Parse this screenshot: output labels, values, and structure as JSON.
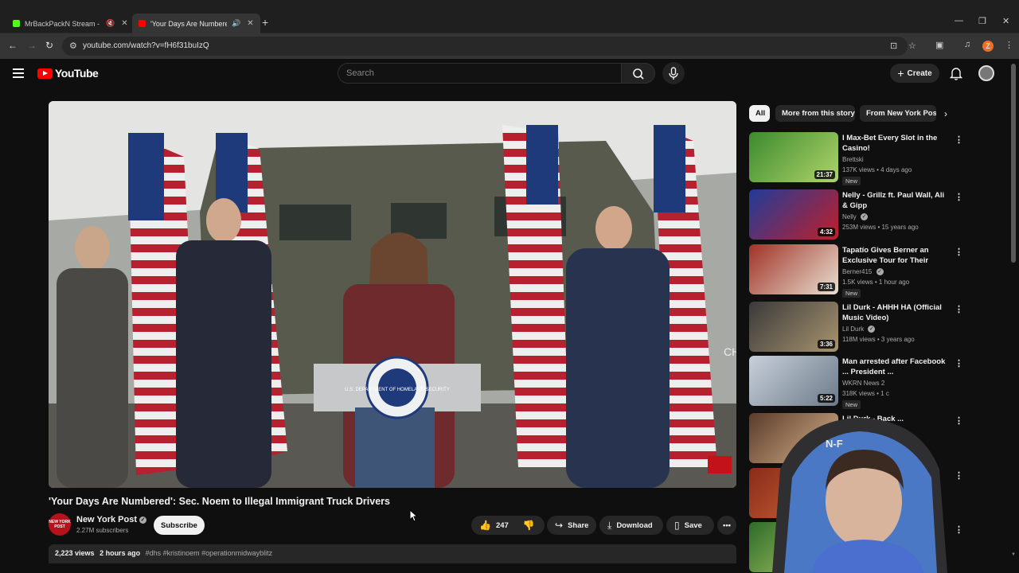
{
  "browser": {
    "tabs": [
      {
        "title": "MrBackPackN Stream - Wa",
        "favicon_color": "#53fc18",
        "active": false
      },
      {
        "title": "'Your Days Are Numbered':",
        "favicon_color": "#ff0000",
        "active": true
      }
    ],
    "url": "youtube.com/watch?v=fH6f31buIzQ",
    "profile_initial": "Z"
  },
  "header": {
    "logo_text": "YouTube",
    "search_placeholder": "Search",
    "create_label": "Create"
  },
  "video": {
    "title": "'Your Days Are Numbered': Sec. Noem to Illegal Immigrant Truck Drivers",
    "channel": "New York Post",
    "channel_avatar_text": "NEW YORK POST",
    "subscribers": "2.27M subscribers",
    "subscribe_label": "Subscribe",
    "likes": "247",
    "share_label": "Share",
    "download_label": "Download",
    "save_label": "Save",
    "views": "2,223 views",
    "age": "2 hours ago",
    "tags": "#dhs #kristinoem #operationmidwayblitz",
    "podium_text": "U.S. DEPARTMENT OF HOMELAND SECURITY",
    "overlay_text": "CH"
  },
  "chips": [
    "All",
    "More from this story",
    "From New York Post"
  ],
  "recommendations": [
    {
      "title": "I Max-Bet Every Slot in the Casino!",
      "channel": "Brettski",
      "verified": false,
      "meta": "137K views • 4 days ago",
      "new_label": "New",
      "duration": "21:37",
      "thumb_color": "#3b8a2e"
    },
    {
      "title": "Nelly - Grillz ft. Paul Wall, Ali & Gipp",
      "channel": "Nelly",
      "verified": true,
      "meta": "253M views • 15 years ago",
      "new_label": "",
      "duration": "4:32",
      "thumb_color": "#1f3c9a"
    },
    {
      "title": "Tapatío Gives Berner an Exclusive Tour for Their Chipo...",
      "channel": "Berner415",
      "verified": true,
      "meta": "1.5K views • 1 hour ago",
      "new_label": "New",
      "duration": "7:31",
      "thumb_color": "#a03226"
    },
    {
      "title": "Lil Durk - AHHH HA (Official Music Video)",
      "channel": "Lil Durk",
      "verified": true,
      "meta": "118M views • 3 years ago",
      "new_label": "",
      "duration": "3:36",
      "thumb_color": "#3a3a3a"
    },
    {
      "title": "Man arrested after Facebook ... President ...",
      "channel": "WKRN News 2",
      "verified": false,
      "meta": "318K views • 1 c",
      "new_label": "New",
      "duration": "5:22",
      "thumb_color": "#8b99a8"
    },
    {
      "title": "Lil Durk - Back ...",
      "channel": "",
      "verified": false,
      "meta": "",
      "new_label": "",
      "duration": "",
      "thumb_color": "#5a3b2b"
    },
    {
      "title": "",
      "channel": "",
      "verified": false,
      "meta": "",
      "new_label": "",
      "duration": "",
      "thumb_color": "#8a2a1a"
    },
    {
      "title": "",
      "channel": "",
      "verified": false,
      "meta": "",
      "new_label": "",
      "duration": "",
      "thumb_color": "#2d6a2a"
    }
  ],
  "webcam_text": "N-F",
  "colors": {
    "background": "#0f0f0f",
    "surface": "#272727",
    "accent": "#ff0000"
  }
}
